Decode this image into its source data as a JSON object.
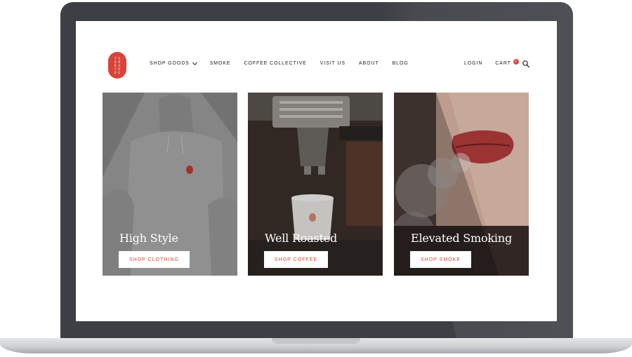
{
  "logo": {
    "lines_left": [
      "T",
      "O",
      "K",
      "Y",
      "O"
    ],
    "lines_right": [
      "S",
      "M",
      "O",
      "K",
      "E"
    ]
  },
  "nav": {
    "items": [
      {
        "label": "SHOP GOODS",
        "has_dropdown": true
      },
      {
        "label": "SMOKE"
      },
      {
        "label": "COFFEE COLLECTIVE"
      },
      {
        "label": "VISIT US"
      },
      {
        "label": "ABOUT"
      },
      {
        "label": "BLOG"
      }
    ],
    "login": "LOGIN",
    "cart": "CART",
    "cart_count": "0",
    "search_icon": "search-icon"
  },
  "cards": [
    {
      "title": "High Style",
      "button": "SHOP CLOTHING",
      "image": "gray hoodie with red logo"
    },
    {
      "title": "Well Roasted",
      "button": "SHOP COFFEE",
      "image": "espresso machine pouring into cup"
    },
    {
      "title": "Elevated Smoking",
      "button": "SHOP SMOKE",
      "image": "red lips exhaling smoke"
    }
  ],
  "colors": {
    "accent": "#d9443a",
    "bezel": "#3c3f44",
    "text": "#222222"
  }
}
